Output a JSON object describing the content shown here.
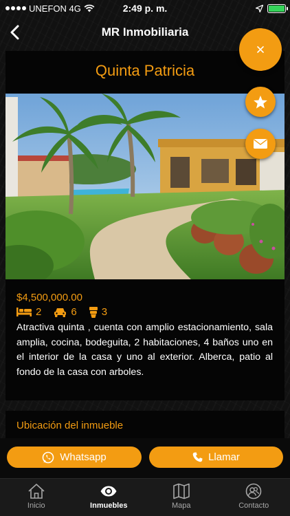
{
  "status_bar": {
    "carrier": "UNEFON 4G",
    "time": "2:49 p. m.",
    "battery_color": "#36d35a",
    "icons": [
      "signal-dots-icon",
      "wifi-icon",
      "location-arrow-icon",
      "battery-icon"
    ]
  },
  "nav": {
    "title": "MR Inmobiliaria",
    "back_icon": "chevron-left-icon"
  },
  "property": {
    "title": "Quinta Patricia",
    "price": "$4,500,000.00",
    "bedrooms": "2",
    "parking": "6",
    "bathrooms": "3",
    "description": "Atractiva quinta , cuenta con amplio estacionamiento, sala amplia, cocina, bodeguita, 2 habitaciones, 4 baños uno en el interior de la casa y uno al exterior. Alberca, patio al fondo de la casa con arboles."
  },
  "location": {
    "title": "Ubicación del inmueble"
  },
  "fab": {
    "close_icon": "close-icon",
    "favorite_icon": "star-icon",
    "email_icon": "mail-icon"
  },
  "actions": {
    "whatsapp_label": "Whatsapp",
    "call_label": "Llamar"
  },
  "tabs": [
    {
      "label": "Inicio",
      "icon": "home-icon",
      "active": false
    },
    {
      "label": "Inmuebles",
      "icon": "eye-icon",
      "active": true
    },
    {
      "label": "Mapa",
      "icon": "map-icon",
      "active": false
    },
    {
      "label": "Contacto",
      "icon": "contacts-icon",
      "active": false
    }
  ],
  "colors": {
    "accent": "#f39c12",
    "background": "#111111",
    "card": "#050505",
    "tab_bar": "#1a1a1a"
  }
}
